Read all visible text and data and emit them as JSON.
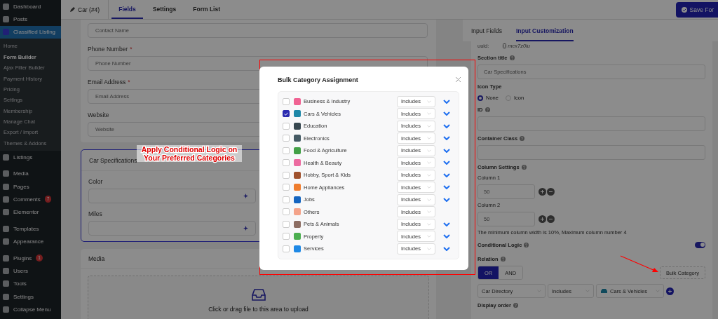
{
  "sidebar": {
    "items": [
      {
        "label": "Dashboard",
        "selected": false
      },
      {
        "label": "Posts",
        "selected": false
      },
      {
        "label": "Classified Listing",
        "selected": true,
        "children": [
          {
            "label": "Home",
            "selected": false
          },
          {
            "label": "Form Builder",
            "selected": true
          },
          {
            "label": "Ajax Filter Builder",
            "selected": false
          },
          {
            "label": "Payment History",
            "selected": false
          },
          {
            "label": "Pricing",
            "selected": false
          },
          {
            "label": "Settings",
            "selected": false
          },
          {
            "label": "Membership",
            "selected": false
          },
          {
            "label": "Manage Chat",
            "selected": false
          },
          {
            "label": "Export / Import",
            "selected": false
          },
          {
            "label": "Themes & Addons",
            "selected": false
          }
        ]
      },
      {
        "label": "Listings",
        "selected": false
      },
      {
        "label": "Media",
        "selected": false
      },
      {
        "label": "Pages",
        "selected": false
      },
      {
        "label": "Comments",
        "selected": false,
        "badge": "7"
      },
      {
        "label": "Elementor",
        "selected": false
      },
      {
        "label": "Templates",
        "selected": false
      },
      {
        "label": "Appearance",
        "selected": false
      },
      {
        "label": "Plugins",
        "selected": false,
        "badge": "1"
      },
      {
        "label": "Users",
        "selected": false
      },
      {
        "label": "Tools",
        "selected": false
      },
      {
        "label": "Settings",
        "selected": false
      },
      {
        "label": "Collapse Menu",
        "selected": false
      }
    ]
  },
  "topbar": {
    "form_title": "Car (#4)",
    "tabs": [
      {
        "label": "Fields",
        "selected": true
      },
      {
        "label": "Settings",
        "selected": false
      },
      {
        "label": "Form List",
        "selected": false
      }
    ],
    "save_button": "Save For"
  },
  "form": {
    "fields": [
      {
        "placeholder": "Contact Name"
      },
      {
        "label": "Phone Number",
        "required_mark": "*",
        "placeholder": "Phone Number"
      },
      {
        "label": "Email Address",
        "required_mark": "*",
        "placeholder": "Email Address"
      },
      {
        "label": "Website",
        "placeholder": "Website"
      }
    ],
    "car_specs": {
      "title": "Car Specifications",
      "fields": [
        {
          "label": "Color"
        },
        {
          "label": "Miles"
        }
      ]
    },
    "media": {
      "title": "Media",
      "upload_text": "Click or drag file to this area to upload"
    }
  },
  "callout": "Apply Conditional Logic on Your Preferred Categories",
  "modal": {
    "title": "Bulk Category Assignment",
    "categories": [
      {
        "label": "Business & Industry",
        "checked": false,
        "operator": "Includes",
        "expandable": true,
        "color": "#f06292"
      },
      {
        "label": "Cars & Vehicles",
        "checked": true,
        "operator": "Includes",
        "expandable": true,
        "color": "#1e88a8"
      },
      {
        "label": "Education",
        "checked": false,
        "operator": "Includes",
        "expandable": true,
        "color": "#37474f"
      },
      {
        "label": "Electronics",
        "checked": false,
        "operator": "Includes",
        "expandable": true,
        "color": "#455a64"
      },
      {
        "label": "Food & Agriculture",
        "checked": false,
        "operator": "Includes",
        "expandable": true,
        "color": "#43a047"
      },
      {
        "label": "Health & Beauty",
        "checked": false,
        "operator": "Includes",
        "expandable": true,
        "color": "#ec6ba0"
      },
      {
        "label": "Hobby, Sport & Kids",
        "checked": false,
        "operator": "Includes",
        "expandable": true,
        "color": "#a0522d"
      },
      {
        "label": "Home Appliances",
        "checked": false,
        "operator": "Includes",
        "expandable": true,
        "color": "#ef7d2e"
      },
      {
        "label": "Jobs",
        "checked": false,
        "operator": "Includes",
        "expandable": true,
        "color": "#1565c0"
      },
      {
        "label": "Others",
        "checked": false,
        "operator": "Includes",
        "expandable": false,
        "color": "#f4a38a"
      },
      {
        "label": "Pets & Animals",
        "checked": false,
        "operator": "Includes",
        "expandable": true,
        "color": "#8d6e63"
      },
      {
        "label": "Property",
        "checked": false,
        "operator": "Includes",
        "expandable": true,
        "color": "#4caf50"
      },
      {
        "label": "Services",
        "checked": false,
        "operator": "Includes",
        "expandable": true,
        "color": "#1e88e5"
      }
    ]
  },
  "right_panel": {
    "tabs": [
      {
        "label": "Input Fields",
        "selected": false
      },
      {
        "label": "Input Customization",
        "selected": true
      }
    ],
    "uuid_label": "uuid:",
    "uuid": "mcx7z0iu",
    "section_title": {
      "label": "Section title",
      "help": true,
      "value": "Car Specifications"
    },
    "icon_type": {
      "label": "Icon Type",
      "options": [
        {
          "label": "None",
          "selected": true
        },
        {
          "label": "Icon",
          "selected": false
        }
      ]
    },
    "id_field": {
      "label": "ID",
      "help": true
    },
    "container_class": {
      "label": "Container Class",
      "help": true
    },
    "column_settings": {
      "label": "Column Settings",
      "help": true,
      "columns": [
        {
          "label": "Column 1",
          "value": "50"
        },
        {
          "label": "Column 2",
          "value": "50"
        }
      ],
      "note": "The minimum column width is 10%, Maximum column number 4"
    },
    "conditional_logic": {
      "label": "Conditional Logic",
      "help": true,
      "on": true
    },
    "relation": {
      "label": "Relation",
      "help": true,
      "options": [
        {
          "label": "OR",
          "selected": true
        },
        {
          "label": "AND",
          "selected": false
        }
      ]
    },
    "bulk_button": "Bulk Category",
    "rule": {
      "source": "Car Directory",
      "operator": "Includes",
      "category": "Cars & Vehicles"
    },
    "display_order": {
      "label": "Display order",
      "help": true
    }
  }
}
